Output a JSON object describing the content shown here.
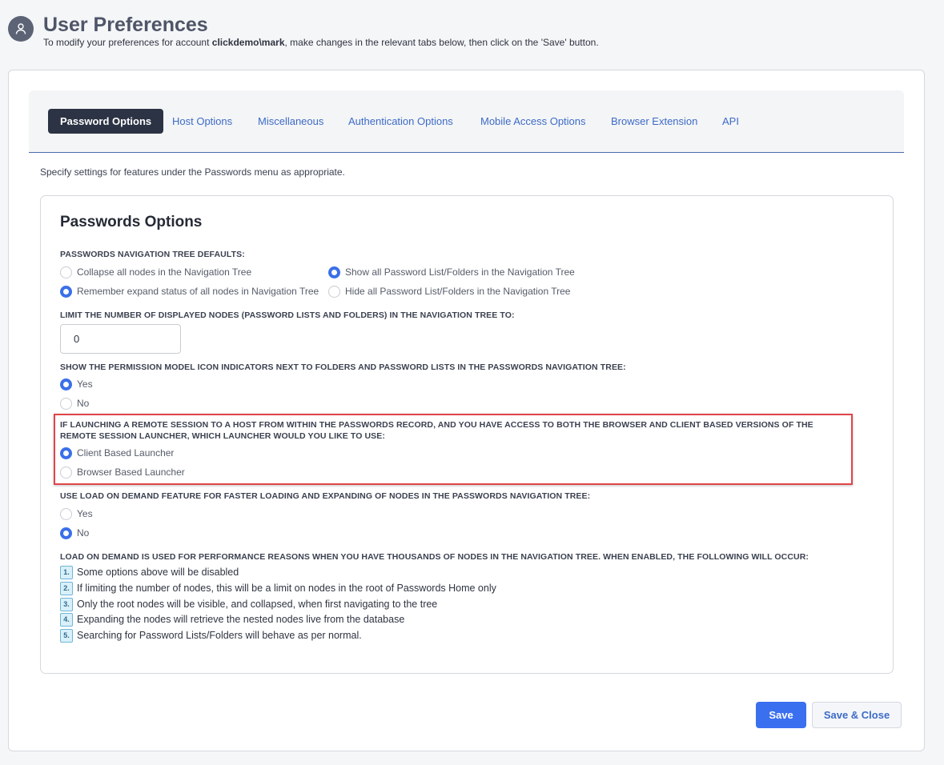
{
  "header": {
    "title": "User Preferences",
    "subtitle_prefix": "To modify your preferences for account ",
    "account": "clickdemo\\mark",
    "subtitle_suffix": ", make changes in the relevant tabs below, then click on the 'Save' button."
  },
  "tabs": [
    {
      "label": "Password Options",
      "active": true
    },
    {
      "label": "Host Options"
    },
    {
      "label": "Miscellaneous"
    },
    {
      "label": "Authentication Options"
    },
    {
      "label": "Mobile Access Options"
    },
    {
      "label": "Browser Extension"
    },
    {
      "label": "API"
    }
  ],
  "description": "Specify settings for features under the Passwords menu as appropriate.",
  "section": {
    "title": "Passwords Options",
    "nav_defaults": {
      "label": "PASSWORDS NAVIGATION TREE DEFAULTS:",
      "options": [
        {
          "label": "Collapse all nodes in the Navigation Tree",
          "checked": false
        },
        {
          "label": "Show all Password List/Folders in the Navigation Tree",
          "checked": true
        },
        {
          "label": "Remember expand status of all nodes in Navigation Tree",
          "checked": true
        },
        {
          "label": "Hide all Password List/Folders in the Navigation Tree",
          "checked": false
        }
      ]
    },
    "limit": {
      "label": "LIMIT THE NUMBER OF DISPLAYED NODES (PASSWORD LISTS AND FOLDERS) IN THE NAVIGATION TREE TO:",
      "value": "0"
    },
    "permission_icons": {
      "label": "SHOW THE PERMISSION MODEL ICON INDICATORS NEXT TO FOLDERS AND PASSWORD LISTS IN THE PASSWORDS NAVIGATION TREE:",
      "options": [
        {
          "label": "Yes",
          "checked": true
        },
        {
          "label": "No",
          "checked": false
        }
      ]
    },
    "launcher": {
      "label_line1": "IF LAUNCHING A REMOTE SESSION TO A HOST FROM WITHIN THE PASSWORDS RECORD, AND YOU HAVE ACCESS TO BOTH THE BROWSER AND CLIENT BASED VERSIONS OF THE",
      "label_line2": "REMOTE SESSION LAUNCHER, WHICH LAUNCHER WOULD YOU LIKE TO USE:",
      "options": [
        {
          "label": "Client Based Launcher",
          "checked": true
        },
        {
          "label": "Browser Based Launcher",
          "checked": false
        }
      ]
    },
    "load_on_demand": {
      "label": "USE LOAD ON DEMAND FEATURE FOR FASTER LOADING AND EXPANDING OF NODES IN THE PASSWORDS NAVIGATION TREE:",
      "options": [
        {
          "label": "Yes",
          "checked": false
        },
        {
          "label": "No",
          "checked": true
        }
      ]
    },
    "lod_info": {
      "label": "LOAD ON DEMAND IS USED FOR PERFORMANCE REASONS WHEN YOU HAVE THOUSANDS OF NODES IN THE NAVIGATION TREE. WHEN ENABLED, THE FOLLOWING WILL OCCUR:",
      "items": [
        {
          "num": "1.",
          "text": "Some options above will be disabled"
        },
        {
          "num": "2.",
          "text": "If limiting the number of nodes, this will be a limit on nodes in the root of Passwords Home only"
        },
        {
          "num": "3.",
          "text": "Only the root nodes will be visible, and collapsed, when first navigating to the tree"
        },
        {
          "num": "4.",
          "text": "Expanding the nodes will retrieve the nested nodes live from the database"
        },
        {
          "num": "5.",
          "text": "Searching for Password Lists/Folders will behave as per normal."
        }
      ]
    }
  },
  "buttons": {
    "save": "Save",
    "save_close": "Save & Close"
  },
  "colors": {
    "accent": "#3a6ff0",
    "tab_active_bg": "#2b3344",
    "highlight_border": "#e0454a"
  }
}
